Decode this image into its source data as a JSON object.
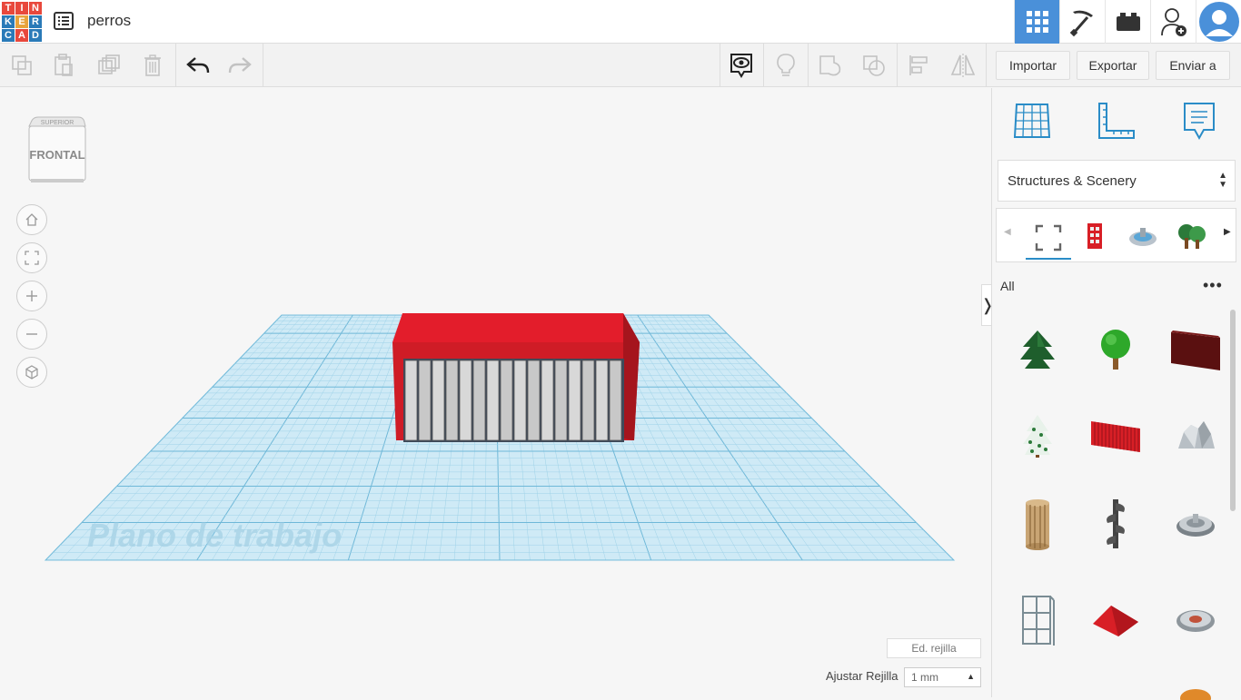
{
  "app": {
    "logo_letters": [
      "T",
      "I",
      "N",
      "K",
      "E",
      "R",
      "C",
      "A",
      "D"
    ],
    "logo_colors": [
      "#e8483c",
      "#e8483c",
      "#e8483c",
      "#2a7ab8",
      "#e8a33c",
      "#2a7ab8",
      "#2a7ab8",
      "#e8483c",
      "#2a7ab8"
    ],
    "design_title": "perros"
  },
  "topbar": {
    "icons": [
      "grid-view-icon",
      "pickaxe-icon",
      "bricks-icon",
      "add-user-icon",
      "user-avatar-icon"
    ],
    "accent": "#4a90d9"
  },
  "toolbar": {
    "buttons": [
      "copy-icon",
      "paste-icon",
      "duplicate-icon",
      "delete-icon",
      "undo-icon",
      "redo-icon",
      "show-hide-icon",
      "light-bulb-icon",
      "group-icon",
      "ungroup-icon",
      "align-icon",
      "mirror-icon"
    ],
    "import_label": "Importar",
    "export_label": "Exportar",
    "send_label": "Enviar a"
  },
  "viewport": {
    "viewcube_front": "FRONTAL",
    "viewcube_top": "SUPERIOR",
    "workplane_label": "Plano de trabajo",
    "edit_grid_label": "Ed. rejilla",
    "snap_grid_label": "Ajustar Rejilla",
    "snap_grid_value": "1 mm",
    "collapse_glyph": "❭"
  },
  "panel": {
    "tabs": [
      "workplane-icon",
      "ruler-icon",
      "notes-icon"
    ],
    "category": "Structures & Scenery",
    "filter_label": "All",
    "more_glyph": "•••",
    "shapes": [
      "pine-tree",
      "round-tree",
      "wall-panel",
      "snowy-pine-tree",
      "red-fence",
      "rock",
      "round-tower",
      "spiral-stair",
      "fountain",
      "scaffold-tower",
      "red-roof",
      "round-base"
    ],
    "colors": {
      "red": "#d81f26",
      "green": "#2c7a3a",
      "darkred": "#5a1010",
      "grid": "#a8d8ec",
      "tab_blue": "#2a8cc7"
    }
  }
}
